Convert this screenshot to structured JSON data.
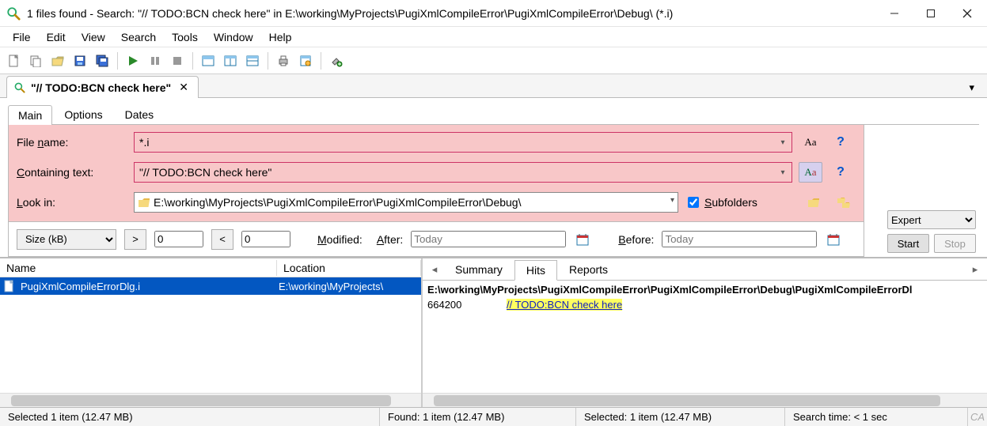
{
  "window": {
    "title": "1 files found - Search: \"// TODO:BCN check here\" in E:\\working\\MyProjects\\PugiXmlCompileError\\PugiXmlCompileError\\Debug\\ (*.i)"
  },
  "menus": [
    "File",
    "Edit",
    "View",
    "Search",
    "Tools",
    "Window",
    "Help"
  ],
  "toolbar_icons": [
    "new",
    "copy",
    "open",
    "save",
    "save-all",
    "sep",
    "run",
    "pause",
    "stop",
    "sep",
    "pane1",
    "pane2",
    "pane3",
    "sep",
    "print",
    "options",
    "sep",
    "plugins"
  ],
  "search_tab": {
    "label": "\"// TODO:BCN check here\""
  },
  "form": {
    "tabs": [
      "Main",
      "Options",
      "Dates"
    ],
    "active_tab": 0,
    "file_name_label_html": "File <u>n</u>ame:",
    "file_name_value": "*.i",
    "containing_label_html": "<u>C</u>ontaining text:",
    "containing_value": "\"// TODO:BCN check here\"",
    "lookin_label_html": "<u>L</u>ook in:",
    "lookin_value": "E:\\working\\MyProjects\\PugiXmlCompileError\\PugiXmlCompileError\\Debug\\",
    "subfolders_label_html": "<u>S</u>ubfolders",
    "subfolders_checked": true,
    "mode_options": [
      "Expert"
    ],
    "mode_selected": "Expert",
    "start_label": "Start",
    "stop_label": "Stop",
    "size_label": "Size (kB)",
    "size_lo": "0",
    "size_hi": "0",
    "modified_label_html": "<u>M</u>odified:",
    "after_label_html": "<u>A</u>fter:",
    "after_value": "Today",
    "before_label_html": "<u>B</u>efore:",
    "before_value": "Today"
  },
  "left_pane": {
    "col_name": "Name",
    "col_location": "Location",
    "rows": [
      {
        "name": "PugiXmlCompileErrorDlg.i",
        "location": "E:\\working\\MyProjects\\"
      }
    ]
  },
  "right_pane": {
    "tabs": [
      "Summary",
      "Hits",
      "Reports"
    ],
    "active_tab": 1,
    "path": "E:\\working\\MyProjects\\PugiXmlCompileError\\PugiXmlCompileError\\Debug\\PugiXmlCompileErrorDl",
    "hits": [
      {
        "line": "664200",
        "text": "// TODO:BCN check here"
      }
    ]
  },
  "status": {
    "sel_left": "Selected 1 item (12.47 MB)",
    "found": "Found: 1 item (12.47 MB)",
    "sel_right": "Selected: 1 item (12.47 MB)",
    "time": "Search time: < 1 sec",
    "case": "CA"
  }
}
